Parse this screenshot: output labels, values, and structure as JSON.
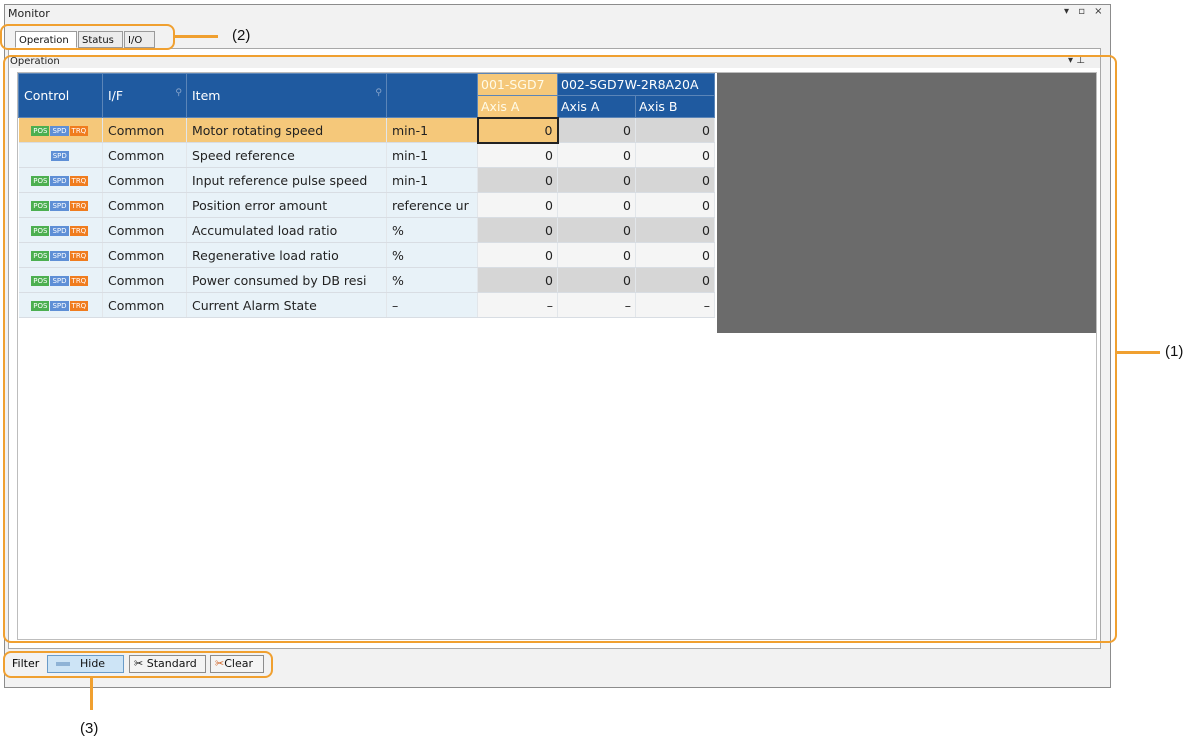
{
  "window": {
    "title": "Monitor",
    "controls": "▾ ▫ ×"
  },
  "tabs": [
    {
      "label": "Operation"
    },
    {
      "label": "Status"
    },
    {
      "label": "I/O"
    }
  ],
  "pane": {
    "title": "Operation",
    "icons": "▾ ⊥"
  },
  "grid": {
    "headers": {
      "control": "Control",
      "if": "I/F",
      "item": "Item",
      "unit": "",
      "dev1": "001-SGD7",
      "dev2": "002-SGD7W-2R8A20A",
      "axisA1": "Axis A",
      "axisA2": "Axis A",
      "axisB2": "Axis B"
    },
    "rows": [
      {
        "control": "POS SPD TRQ",
        "if": "Common",
        "item": "Motor rotating speed",
        "unit": "min-1",
        "v1": "0",
        "v2": "0",
        "v3": "0"
      },
      {
        "control": "SPD",
        "if": "Common",
        "item": "Speed reference",
        "unit": "min-1",
        "v1": "0",
        "v2": "0",
        "v3": "0"
      },
      {
        "control": "POS SPD TRQ",
        "if": "Common",
        "item": "Input reference pulse speed",
        "unit": "min-1",
        "v1": "0",
        "v2": "0",
        "v3": "0"
      },
      {
        "control": "POS SPD TRQ",
        "if": "Common",
        "item": "Position error amount",
        "unit": "reference ur",
        "v1": "0",
        "v2": "0",
        "v3": "0"
      },
      {
        "control": "POS SPD TRQ",
        "if": "Common",
        "item": "Accumulated load ratio",
        "unit": "%",
        "v1": "0",
        "v2": "0",
        "v3": "0"
      },
      {
        "control": "POS SPD TRQ",
        "if": "Common",
        "item": "Regenerative load ratio",
        "unit": "%",
        "v1": "0",
        "v2": "0",
        "v3": "0"
      },
      {
        "control": "POS SPD TRQ",
        "if": "Common",
        "item": "Power consumed by DB resi",
        "unit": "%",
        "v1": "0",
        "v2": "0",
        "v3": "0"
      },
      {
        "control": "POS SPD TRQ",
        "if": "Common",
        "item": "Current Alarm State",
        "unit": "–",
        "v1": "–",
        "v2": "–",
        "v3": "–"
      }
    ]
  },
  "tags": {
    "pos": "POS",
    "spd": "SPD",
    "trq": "TRQ"
  },
  "filter": {
    "label": "Filter",
    "hide": "Hide",
    "standard": "Standard",
    "clear": "Clear"
  },
  "callouts": {
    "c1": "(1)",
    "c2": "(2)",
    "c3": "(3)"
  },
  "colors": {
    "header_blue": "#1f5aa0",
    "selected_orange": "#f5c87a",
    "callout": "#f0a030"
  }
}
